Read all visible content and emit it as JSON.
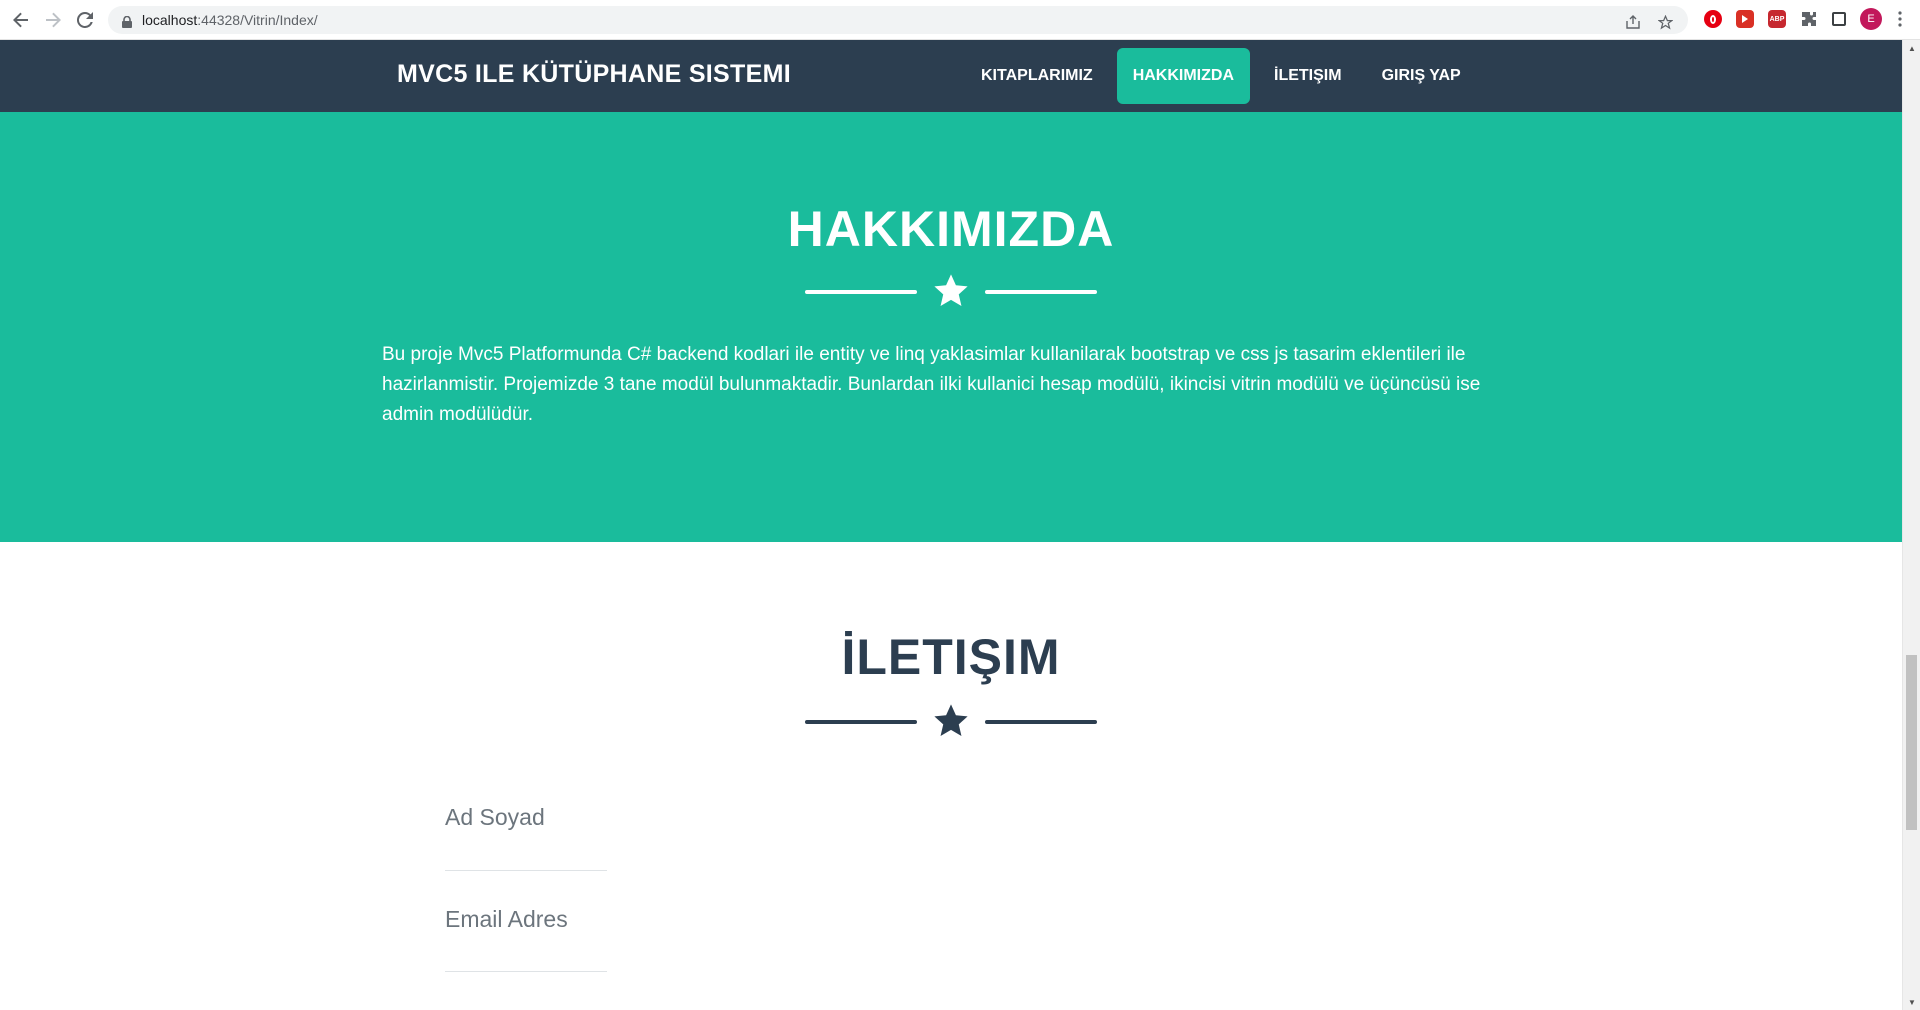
{
  "browser": {
    "url_host": "localhost",
    "url_path": ":44328/Vitrin/Index/",
    "profile_initial": "E",
    "icons": [
      "back-icon",
      "forward-icon",
      "reload-icon",
      "lock-icon",
      "share-icon",
      "star-icon",
      "opera-extension-icon",
      "record-extension-icon",
      "adblock-extension-icon",
      "extensions-puzzle-icon",
      "side-panel-icon",
      "profile-avatar",
      "menu-dots-icon"
    ],
    "abp_label": "ABP"
  },
  "nav": {
    "brand": "MVC5 ILE KÜTÜPHANE SISTEMI",
    "items": [
      {
        "label": "KITAPLARIMIZ",
        "active": false
      },
      {
        "label": "HAKKIMIZDA",
        "active": true
      },
      {
        "label": "İLETIŞIM",
        "active": false
      },
      {
        "label": "GIRIŞ YAP",
        "active": false
      }
    ]
  },
  "about": {
    "title": "HAKKIMIZDA",
    "text": "Bu proje Mvc5 Platformunda C# backend kodlari ile entity ve linq yaklasimlar kullanilarak bootstrap ve css js tasarim eklentileri ile hazirlanmistir. Projemizde 3 tane modül bulunmaktadir. Bunlardan ilki kullanici hesap modülü, ikincisi vitrin modülü ve üçüncüsü ise admin modülüdür.",
    "divider_icon": "star-icon"
  },
  "contact": {
    "title": "İLETIŞIM",
    "divider_icon": "star-icon",
    "fields": [
      {
        "placeholder": "Ad Soyad",
        "value": ""
      },
      {
        "placeholder": "Email Adres",
        "value": ""
      }
    ]
  },
  "colors": {
    "navbar": "#2c3e50",
    "accent": "#1abc9c",
    "text_dark": "#2c3e50",
    "placeholder": "#6c757d"
  }
}
